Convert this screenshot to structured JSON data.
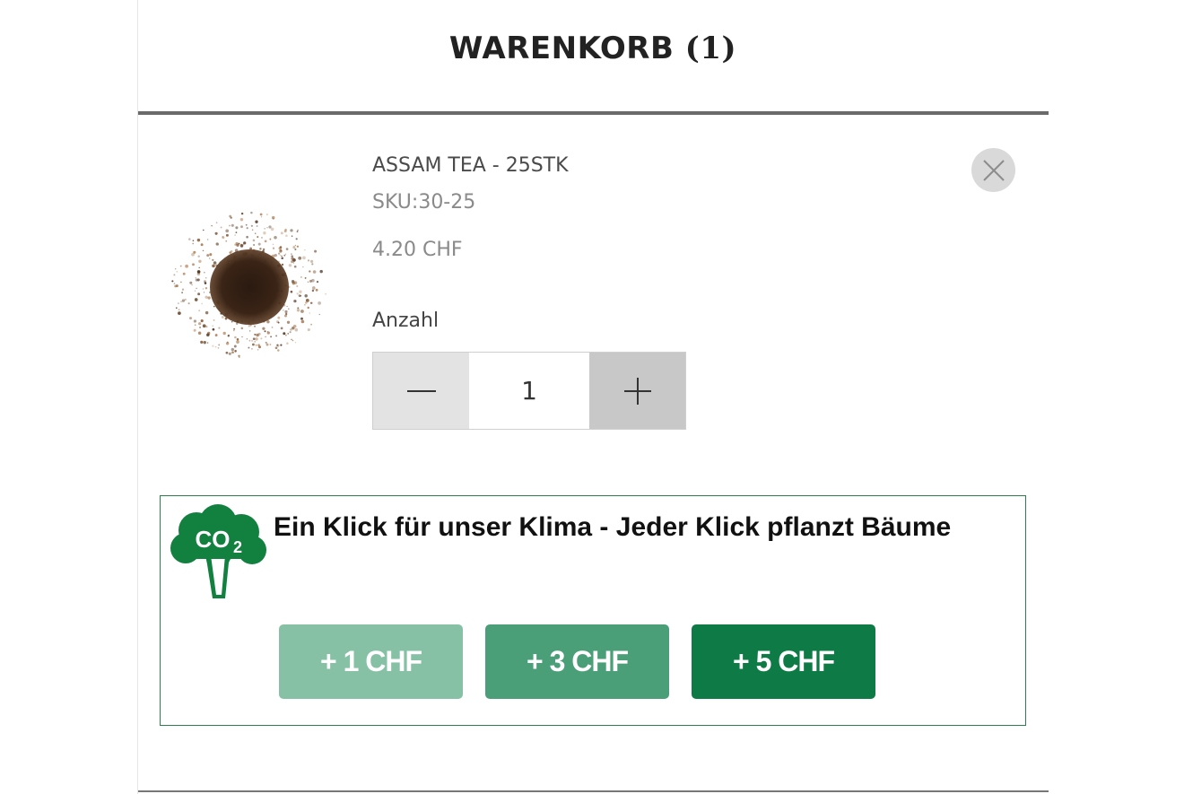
{
  "cart": {
    "title": "WARENKORB",
    "count": "(1)"
  },
  "item": {
    "name": "ASSAM TEA - 25STK",
    "sku": "SKU:30-25",
    "price": "4.20 CHF",
    "quantity_label": "Anzahl",
    "quantity": "1",
    "remove_icon": "close-icon",
    "minus_icon": "minus-icon",
    "plus_icon": "plus-icon"
  },
  "climate": {
    "icon": "co2-tree-icon",
    "icon_text": "CO2",
    "text": "Ein Klick für unser Klima - Jeder Klick pflanzt Bäume",
    "buttons": [
      {
        "label": "+ 1 CHF",
        "color": "#86c1a6"
      },
      {
        "label": "+ 3 CHF",
        "color": "#4a9e78"
      },
      {
        "label": "+ 5 CHF",
        "color": "#0e7a45"
      }
    ],
    "border_color": "#2e7d4f",
    "icon_color": "#12803f"
  }
}
